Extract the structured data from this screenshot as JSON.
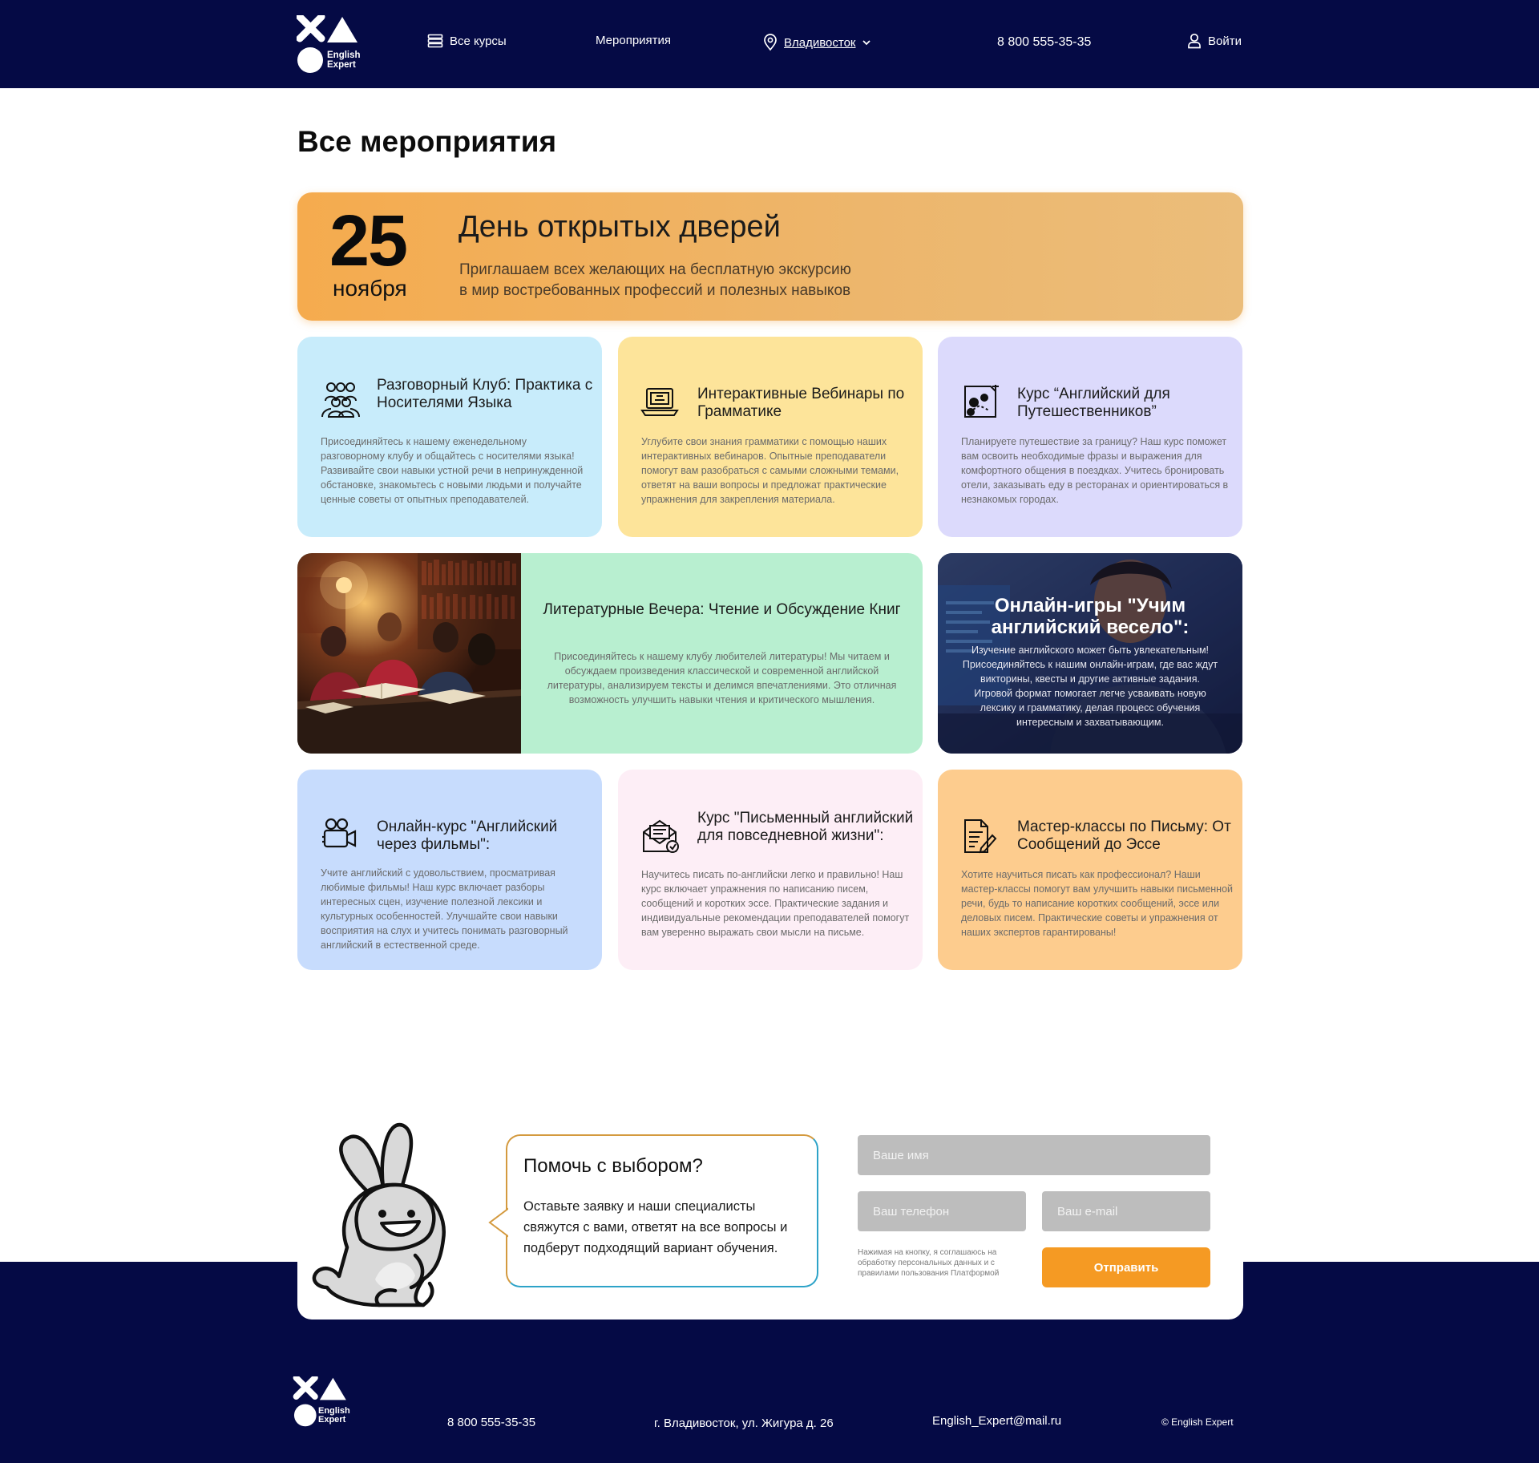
{
  "header": {
    "logo_text_line1": "English",
    "logo_text_line2": "Expert",
    "nav_courses": "Все курсы",
    "nav_events": "Мероприятия",
    "nav_city": "Владивосток",
    "nav_phone": "8 800 555-35-35",
    "nav_login": "Войти"
  },
  "page": {
    "title": "Все мероприятия"
  },
  "hero": {
    "day": "25",
    "month": "ноября",
    "title": "День открытых дверей",
    "text_line1": "Приглашаем всех желающих на бесплатную экскурсию",
    "text_line2": "в мир востребованных профессий и полезных навыков"
  },
  "cards": [
    {
      "icon": "people-group-icon",
      "title": "Разговорный Клуб: Практика с Носителями Языка",
      "text": "Присоединяйтесь к нашему еженедельному разговорному клубу и общайтесь с носителями языка! Развивайте свои навыки устной речи в непринужденной обстановке, знакомьтесь с новыми людьми и получайте ценные советы от опытных преподавателей.",
      "color": "#c8ecfb"
    },
    {
      "icon": "laptop-icon",
      "title": "Интерактивные Вебинары по Грамматике",
      "text": "Углубите свои знания грамматики с помощью наших интерактивных вебинаров. Опытные преподаватели помогут вам разобраться с самыми сложными темами, ответят на ваши вопросы и предложат практические упражнения для закрепления материала.",
      "color": "#fde49a"
    },
    {
      "icon": "travel-map-icon",
      "title": "Курс “Английский для Путешественников”",
      "text": "Планируете путешествие за границу? Наш курс поможет вам освоить необходимые фразы и выражения для комфортного общения в поездках. Учитесь бронировать отели, заказывать еду в ресторанах и ориентироваться в незнакомых городах.",
      "color": "#dcdafc"
    },
    {
      "icon": "movie-camera-icon",
      "title": "Онлайн-курс \"Английский через фильмы\":",
      "text": "Учите английский с удовольствием, просматривая любимые фильмы! Наш курс включает разборы интересных сцен, изучение полезной лексики и культурных особенностей. Улучшайте свои навыки восприятия на слух и учитесь понимать разговорный английский в естественной среде.",
      "color": "#c7dcfd"
    },
    {
      "icon": "letter-envelope-icon",
      "title": "Курс \"Письменный английский для повседневной жизни\":",
      "text": "Научитесь писать по-английски легко и правильно! Наш курс включает упражнения по написанию писем, сообщений и коротких эссе. Практические задания и индивидуальные рекомендации преподавателей помогут вам уверенно выражать свои мысли на письме.",
      "color": "#fdeef6"
    },
    {
      "icon": "document-pen-icon",
      "title": "Мастер-классы по Письму: От Сообщений до Эссе",
      "text": "Хотите научиться писать как профессионал? Наши мастер-классы помогут вам улучшить навыки письменной речи, будь то написание коротких сообщений, эссе или деловых писем. Практические советы и упражнения от наших экспертов гарантированы!",
      "color": "#fdcc8e"
    }
  ],
  "literature": {
    "title": "Литературные Вечера: Чтение и Обсуждение Книг",
    "text": "Присоединяйтесь к нашему клубу любителей литературы! Мы читаем и обсуждаем произведения классической и современной английской литературы, анализируем тексты и делимся впечатлениями. Это отличная возможность улучшить навыки чтения и критического мышления."
  },
  "games": {
    "title": "Онлайн-игры \"Учим английский весело\":",
    "text": "Изучение английского может быть увлекательным! Присоединяйтесь к нашим онлайн-играм, где вас ждут викторины, квесты и другие активные задания. Игровой формат помогает легче усваивать новую лексику и грамматику, делая процесс обучения интересным и захватывающим."
  },
  "contact": {
    "title": "Помочь с выбором?",
    "text": "Оставьте заявку и наши специалисты свяжутся с вами, ответят на все вопросы и подберут подходящий вариант обучения.",
    "name_placeholder": "Ваше имя",
    "phone_placeholder": "Ваш телефон",
    "email_placeholder": "Ваш e-mail",
    "consent": "Нажимая на кнопку, я соглашаюсь на обработку персональных данных и с правилами пользования Платформой",
    "submit": "Отправить"
  },
  "footer": {
    "phone": "8 800 555-35-35",
    "address": "г. Владивосток, ул. Жигура д. 26",
    "email": "English_Expert@mail.ru",
    "copyright": "© English Expert"
  },
  "colors": {
    "navy": "#050a45",
    "accent_orange": "#f59a23",
    "literature_bg": "#b8efd0"
  }
}
